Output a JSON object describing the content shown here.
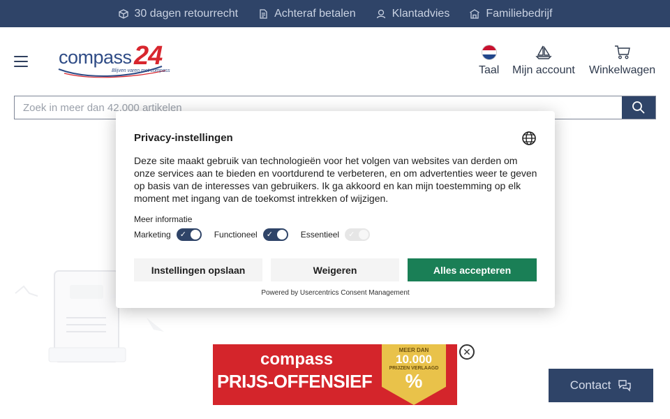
{
  "usp": [
    {
      "icon": "box-icon",
      "label": "30 dagen retourrecht"
    },
    {
      "icon": "invoice-icon",
      "label": "Achteraf betalen"
    },
    {
      "icon": "headset-icon",
      "label": "Klantadvies"
    },
    {
      "icon": "store-icon",
      "label": "Familiebedrijf"
    }
  ],
  "header": {
    "logo_word": "compass",
    "logo_number": "24",
    "logo_tagline": "Blijven varen met compass",
    "language_label": "Taal",
    "account_label": "Mijn account",
    "cart_label": "Winkelwagen"
  },
  "search": {
    "placeholder": "Zoek in meer dan 42.000 artikelen"
  },
  "privacy": {
    "title": "Privacy-instellingen",
    "text": "Deze site maakt gebruik van technologieën voor het volgen van websites van derden om onze services aan te bieden en voortdurend te verbeteren, en om advertenties weer te geven op basis van de interesses van gebruikers. Ik ga akkoord en kan mijn toestemming op elk moment met ingang van de toekomst intrekken of wijzigen.",
    "more_info": "Meer informatie",
    "toggles": [
      {
        "label": "Marketing",
        "state": "on"
      },
      {
        "label": "Functioneel",
        "state": "on"
      },
      {
        "label": "Essentieel",
        "state": "disabled"
      }
    ],
    "save_label": "Instellingen opslaan",
    "deny_label": "Weigeren",
    "accept_label": "Alles accepteren",
    "powered_by": "Powered by Usercentrics Consent Management"
  },
  "promo": {
    "brand": "compass",
    "headline": "PRIJS-OFFENSIEF",
    "badge_line1": "MEER DAN",
    "badge_number": "10.000",
    "badge_line3": "PRIJZEN VERLAAGD",
    "badge_symbol": "%"
  },
  "contact": {
    "label": "Contact"
  },
  "colors": {
    "navy": "#2f4468",
    "accept_green": "#1a7f56",
    "promo_red": "#d4252b",
    "promo_gold": "#e9c24a"
  }
}
